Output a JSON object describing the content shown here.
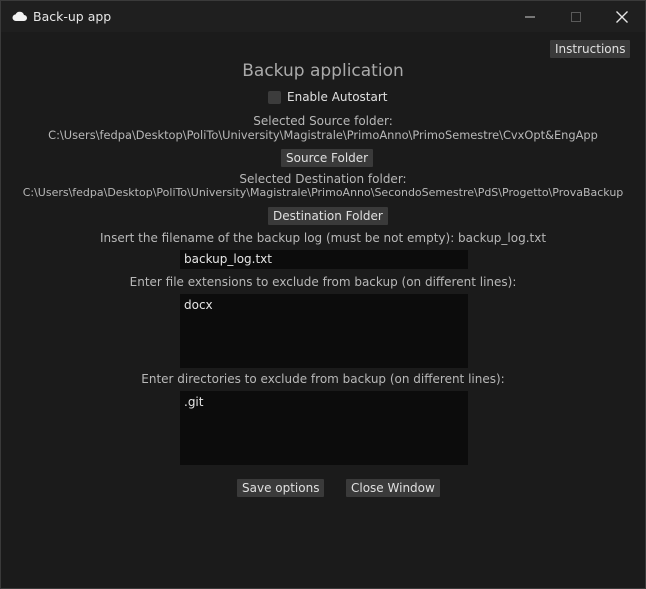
{
  "window": {
    "title": "Back-up app",
    "icons": {
      "app": "cloud-icon",
      "minimize": "minimize-icon",
      "maximize": "maximize-icon",
      "close": "close-icon"
    }
  },
  "toolbar": {
    "instructions_label": "Instructions"
  },
  "main": {
    "heading": "Backup application",
    "autostart": {
      "label": "Enable Autostart",
      "checked": false
    },
    "source": {
      "label": "Selected Source folder:",
      "path": "C:\\Users\\fedpa\\Desktop\\PoliTo\\University\\Magistrale\\PrimoAnno\\PrimoSemestre\\CvxOpt&EngApp",
      "button_label": "Source Folder"
    },
    "destination": {
      "label": "Selected Destination folder:",
      "path": "C:\\Users\\fedpa\\Desktop\\PoliTo\\University\\Magistrale\\PrimoAnno\\SecondoSemestre\\PdS\\Progetto\\ProvaBackup",
      "button_label": "Destination Folder"
    },
    "log": {
      "label": "Insert the filename of the backup log (must be not empty): backup_log.txt",
      "value": "backup_log.txt"
    },
    "extensions": {
      "label": "Enter file extensions to exclude from backup (on different lines):",
      "value": "docx"
    },
    "directories": {
      "label": "Enter directories to exclude from backup (on different lines):",
      "value": ".git"
    },
    "actions": {
      "save_label": "Save options",
      "close_label": "Close Window"
    }
  },
  "colors": {
    "background": "#1b1b1b",
    "button": "#3a3a3a",
    "field": "#0c0c0c",
    "text": "#dcdcdc"
  }
}
